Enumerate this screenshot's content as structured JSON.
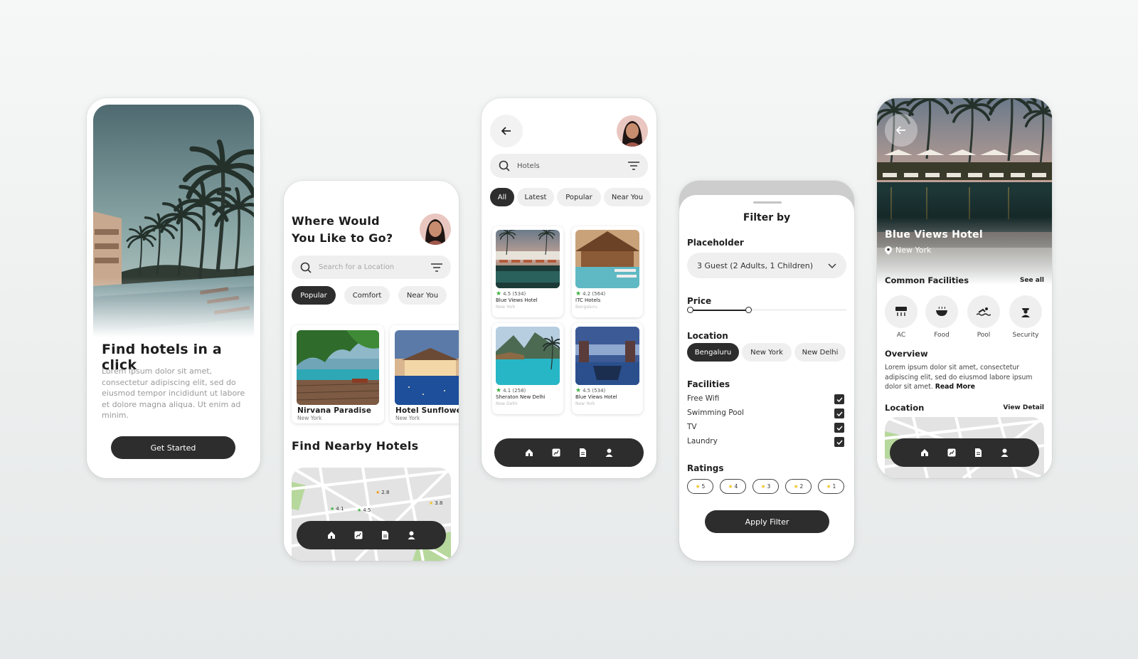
{
  "colors": {
    "dark": "#2d2d2d",
    "chip": "#efefef",
    "star_green": "#3fb13f",
    "star_yellow": "#f2c21b",
    "star_orange": "#f09a1a"
  },
  "screen1": {
    "title": "Find hotels in a click",
    "body": "Lorem ipsum dolor sit amet, consectetur adipiscing elit, sed do eiusmod tempor incididunt ut labore et dolore magna aliqua. Ut enim ad minim.",
    "cta": "Get Started"
  },
  "screen2": {
    "heading_line1": "Where Would",
    "heading_line2": "You Like to Go?",
    "search_placeholder": "Search for a Location",
    "chips": [
      "Popular",
      "Comfort",
      "Near You"
    ],
    "hotels": [
      {
        "name": "Nirvana Paradise",
        "location": "New York"
      },
      {
        "name": "Hotel Sunflower",
        "location": "New York"
      }
    ],
    "nearby_title": "Find Nearby Hotels",
    "map_ratings": [
      "2.8",
      "4.1",
      "4.5",
      "3.8"
    ]
  },
  "screen3": {
    "search_value": "Hotels",
    "chips": [
      "All",
      "Latest",
      "Popular",
      "Near You"
    ],
    "hotels": [
      {
        "rating": "4.5 (534)",
        "name": "Blue Views Hotel",
        "location": "New York"
      },
      {
        "rating": "4.2 (564)",
        "name": "ITC Hotels",
        "location": "Bengaluru"
      },
      {
        "rating": "4.1 (258)",
        "name": "Sheraton New Delhi",
        "location": "New Delhi"
      },
      {
        "rating": "4.5 (534)",
        "name": "Blue Views Hotel",
        "location": "New York"
      }
    ]
  },
  "screen4": {
    "title": "Filter by",
    "placeholder_label": "Placeholder",
    "guests": "3 Guest (2 Adults, 1 Children)",
    "price_label": "Price",
    "price_range": [
      0,
      0.38
    ],
    "location_label": "Location",
    "locations": [
      "Bengaluru",
      "New York",
      "New Delhi"
    ],
    "facilities_label": "Facilities",
    "facilities": [
      "Free Wifi",
      "Swimming Pool",
      "TV",
      "Laundry"
    ],
    "ratings_label": "Ratings",
    "ratings": [
      "5",
      "4",
      "3",
      "2",
      "1"
    ],
    "apply": "Apply Filter"
  },
  "screen5": {
    "hotel_name": "Blue Views Hotel",
    "hotel_location": "New York",
    "facilities_title": "Common Facilities",
    "see_all": "See all",
    "facilities": [
      "AC",
      "Food",
      "Pool",
      "Security"
    ],
    "overview_title": "Overview",
    "overview_text": "Lorem ipsum dolor sit amet, consectetur adipiscing elit, sed do eiusmod labore ipsum dolor sit amet.",
    "read_more": "Read More",
    "location_title": "Location",
    "view_detail": "View Detail"
  },
  "icons": {
    "nav": [
      "home-icon",
      "explore-icon",
      "document-icon",
      "profile-icon"
    ]
  }
}
